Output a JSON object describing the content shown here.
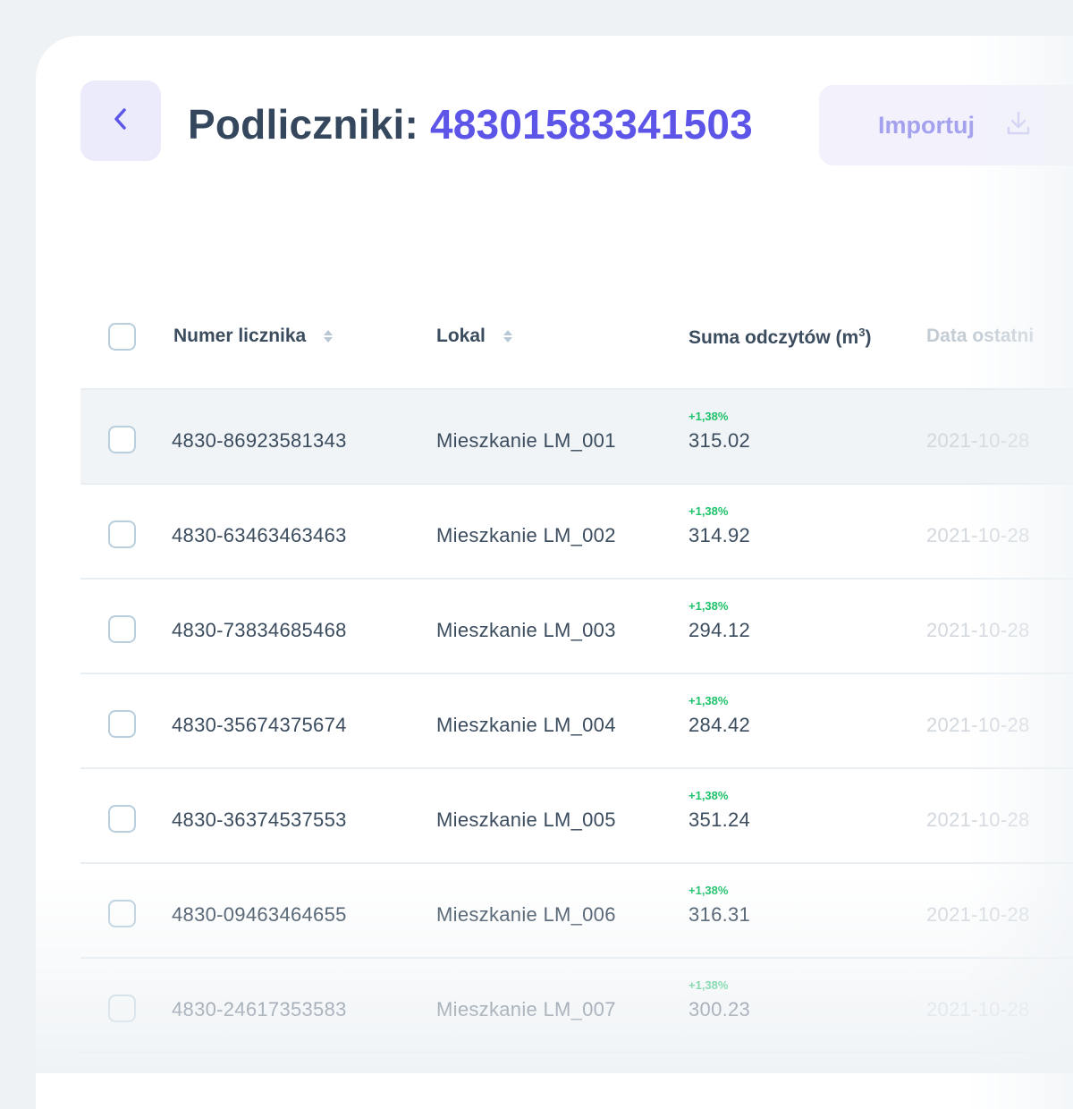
{
  "header": {
    "title_prefix": "Podliczniki:",
    "meter_id": "48301583341503",
    "back_icon": "chevron-left-icon",
    "import_label": "Importuj",
    "import_icon": "download-icon"
  },
  "table": {
    "columns": {
      "meter": "Numer licznika",
      "unit": "Lokal",
      "sum": "Suma odczytów (m",
      "sum_sup": "3",
      "sum_close": ")",
      "date": "Data ostatni"
    },
    "rows": [
      {
        "meter": "4830-86923581343",
        "unit": "Mieszkanie LM_001",
        "delta": "+1,38%",
        "sum": "315.02",
        "date": "2021-10-28"
      },
      {
        "meter": "4830-63463463463",
        "unit": "Mieszkanie LM_002",
        "delta": "+1,38%",
        "sum": "314.92",
        "date": "2021-10-28"
      },
      {
        "meter": "4830-73834685468",
        "unit": "Mieszkanie LM_003",
        "delta": "+1,38%",
        "sum": "294.12",
        "date": "2021-10-28"
      },
      {
        "meter": "4830-35674375674",
        "unit": "Mieszkanie LM_004",
        "delta": "+1,38%",
        "sum": "284.42",
        "date": "2021-10-28"
      },
      {
        "meter": "4830-36374537553",
        "unit": "Mieszkanie LM_005",
        "delta": "+1,38%",
        "sum": "351.24",
        "date": "2021-10-28"
      },
      {
        "meter": "4830-09463464655",
        "unit": "Mieszkanie LM_006",
        "delta": "+1,38%",
        "sum": "316.31",
        "date": "2021-10-28"
      },
      {
        "meter": "4830-24617353583",
        "unit": "Mieszkanie LM_007",
        "delta": "+1,38%",
        "sum": "300.23",
        "date": "2021-10-28"
      }
    ]
  },
  "colors": {
    "accent": "#5c55e8",
    "accent_bg": "#ecebfc",
    "positive": "#1ec26a",
    "text": "#3b4c5e",
    "row_highlight": "#f0f4f7"
  }
}
